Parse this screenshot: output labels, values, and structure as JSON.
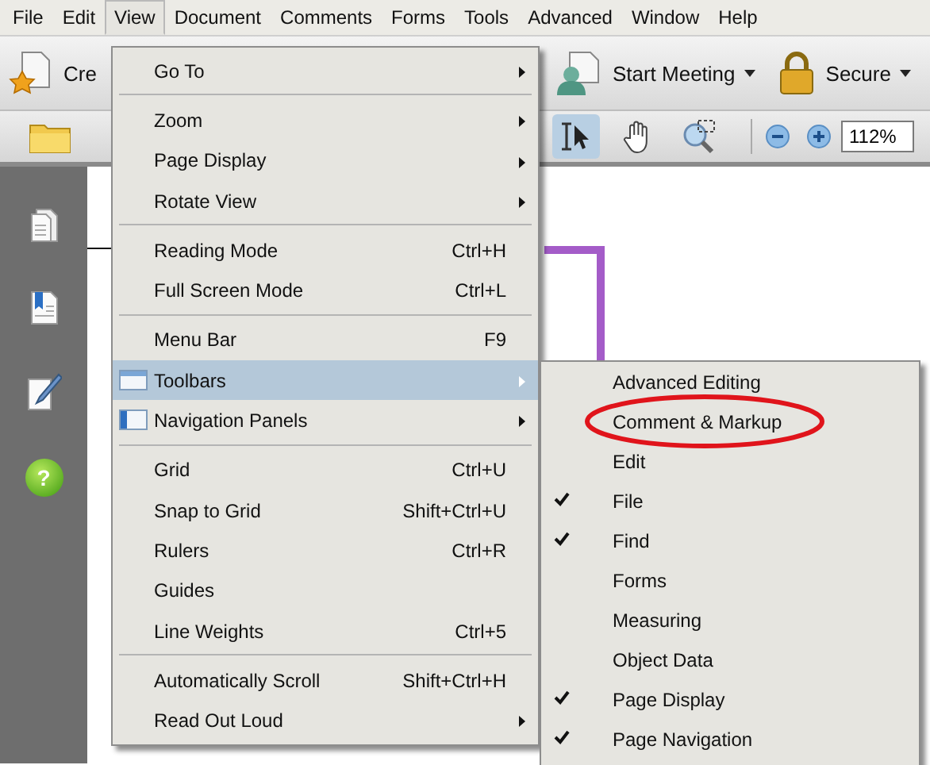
{
  "menubar": [
    {
      "label": "File",
      "selected": false
    },
    {
      "label": "Edit",
      "selected": false
    },
    {
      "label": "View",
      "selected": true
    },
    {
      "label": "Document",
      "selected": false
    },
    {
      "label": "Comments",
      "selected": false
    },
    {
      "label": "Forms",
      "selected": false
    },
    {
      "label": "Tools",
      "selected": false
    },
    {
      "label": "Advanced",
      "selected": false
    },
    {
      "label": "Window",
      "selected": false
    },
    {
      "label": "Help",
      "selected": false
    }
  ],
  "toolbar": {
    "create_label": "Cre",
    "meeting_label": "Start Meeting",
    "secure_label": "Secure",
    "zoom_value": "112%"
  },
  "tools": [
    {
      "kind": "select",
      "selected": true
    },
    {
      "kind": "hand",
      "selected": false
    },
    {
      "kind": "marquee_zoom",
      "selected": false
    }
  ],
  "sidebar": {
    "help_glyph": "?"
  },
  "view_menu": [
    {
      "kind": "plain",
      "label": "Go To",
      "submenu": true,
      "selected": false
    },
    {
      "kind": "separator"
    },
    {
      "kind": "plain",
      "label": "Zoom",
      "submenu": true,
      "selected": false
    },
    {
      "kind": "plain",
      "label": "Page Display",
      "submenu": true,
      "selected": false
    },
    {
      "kind": "plain",
      "label": "Rotate View",
      "submenu": true,
      "selected": false
    },
    {
      "kind": "separator"
    },
    {
      "kind": "plain",
      "label": "Reading Mode",
      "shortcut": "Ctrl+H",
      "submenu": false,
      "selected": false
    },
    {
      "kind": "plain",
      "label": "Full Screen Mode",
      "shortcut": "Ctrl+L",
      "submenu": false,
      "selected": false
    },
    {
      "kind": "separator"
    },
    {
      "kind": "plain",
      "label": "Menu Bar",
      "shortcut": "F9",
      "submenu": false,
      "selected": false
    },
    {
      "kind": "bar_icon",
      "label": "Toolbars",
      "submenu": true,
      "selected": true
    },
    {
      "kind": "pane_icon",
      "label": "Navigation Panels",
      "submenu": true,
      "selected": false
    },
    {
      "kind": "separator"
    },
    {
      "kind": "plain",
      "label": "Grid",
      "shortcut": "Ctrl+U",
      "submenu": false,
      "selected": false
    },
    {
      "kind": "plain",
      "label": "Snap to Grid",
      "shortcut": "Shift+Ctrl+U",
      "submenu": false,
      "selected": false
    },
    {
      "kind": "plain",
      "label": "Rulers",
      "shortcut": "Ctrl+R",
      "submenu": false,
      "selected": false
    },
    {
      "kind": "plain",
      "label": "Guides",
      "submenu": false,
      "selected": false
    },
    {
      "kind": "plain",
      "label": "Line Weights",
      "shortcut": "Ctrl+5",
      "submenu": false,
      "selected": false
    },
    {
      "kind": "separator"
    },
    {
      "kind": "plain",
      "label": "Automatically Scroll",
      "shortcut": "Shift+Ctrl+H",
      "submenu": false,
      "selected": false
    },
    {
      "kind": "plain",
      "label": "Read Out Loud",
      "submenu": true,
      "selected": false
    }
  ],
  "toolbars_submenu": [
    {
      "label": "Advanced Editing",
      "checked": false,
      "circled": false
    },
    {
      "label": "Comment & Markup",
      "checked": false,
      "circled": true
    },
    {
      "label": "Edit",
      "checked": false,
      "circled": false
    },
    {
      "label": "File",
      "checked": true,
      "circled": false
    },
    {
      "label": "Find",
      "checked": true,
      "circled": false
    },
    {
      "label": "Forms",
      "checked": false,
      "circled": false
    },
    {
      "label": "Measuring",
      "checked": false,
      "circled": false
    },
    {
      "label": "Object Data",
      "checked": false,
      "circled": false
    },
    {
      "label": "Page Display",
      "checked": true,
      "circled": false
    },
    {
      "label": "Page Navigation",
      "checked": true,
      "circled": false
    }
  ]
}
